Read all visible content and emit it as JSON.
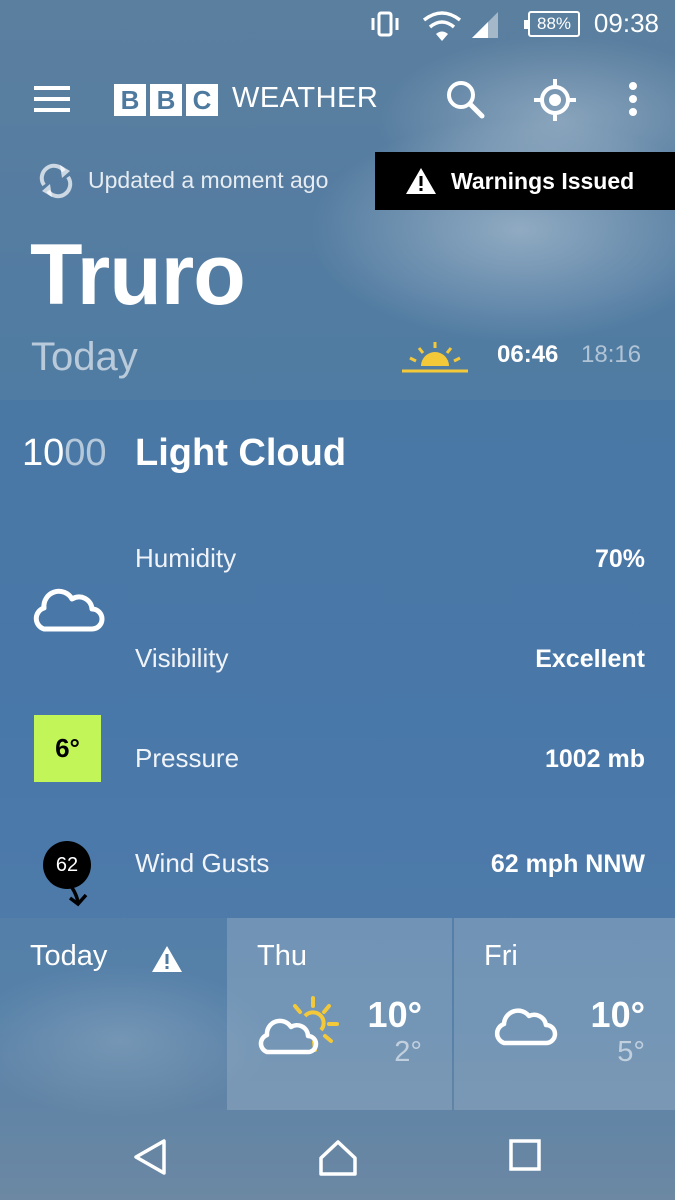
{
  "status_bar": {
    "battery": "88%",
    "time": "09:38"
  },
  "header": {
    "brand_blocks": [
      "B",
      "B",
      "C"
    ],
    "brand_word": "WEATHER"
  },
  "update": {
    "text": "Updated a moment ago",
    "warning": "Warnings Issued"
  },
  "location": {
    "name": "Truro",
    "day": "Today",
    "sunrise": "06:46",
    "sunset": "18:16"
  },
  "current": {
    "hour": "10",
    "minutes": "00",
    "condition": "Light Cloud",
    "temperature": "6°",
    "wind_speed_badge": "62",
    "details": [
      {
        "label": "Humidity",
        "value": "70%"
      },
      {
        "label": "Visibility",
        "value": "Excellent"
      },
      {
        "label": "Pressure",
        "value": "1002 mb"
      },
      {
        "label": "Wind Gusts",
        "value": "62 mph NNW"
      }
    ]
  },
  "forecast": [
    {
      "day": "Today",
      "icon": "warning-icon"
    },
    {
      "day": "Thu",
      "high": "10°",
      "low": "2°",
      "icon": "sun-cloud-icon"
    },
    {
      "day": "Fri",
      "high": "10°",
      "low": "5°",
      "icon": "cloud-icon"
    }
  ],
  "colors": {
    "temp_badge": "#c2f557",
    "sun": "#f3c93a",
    "warning_bg": "#000000"
  }
}
